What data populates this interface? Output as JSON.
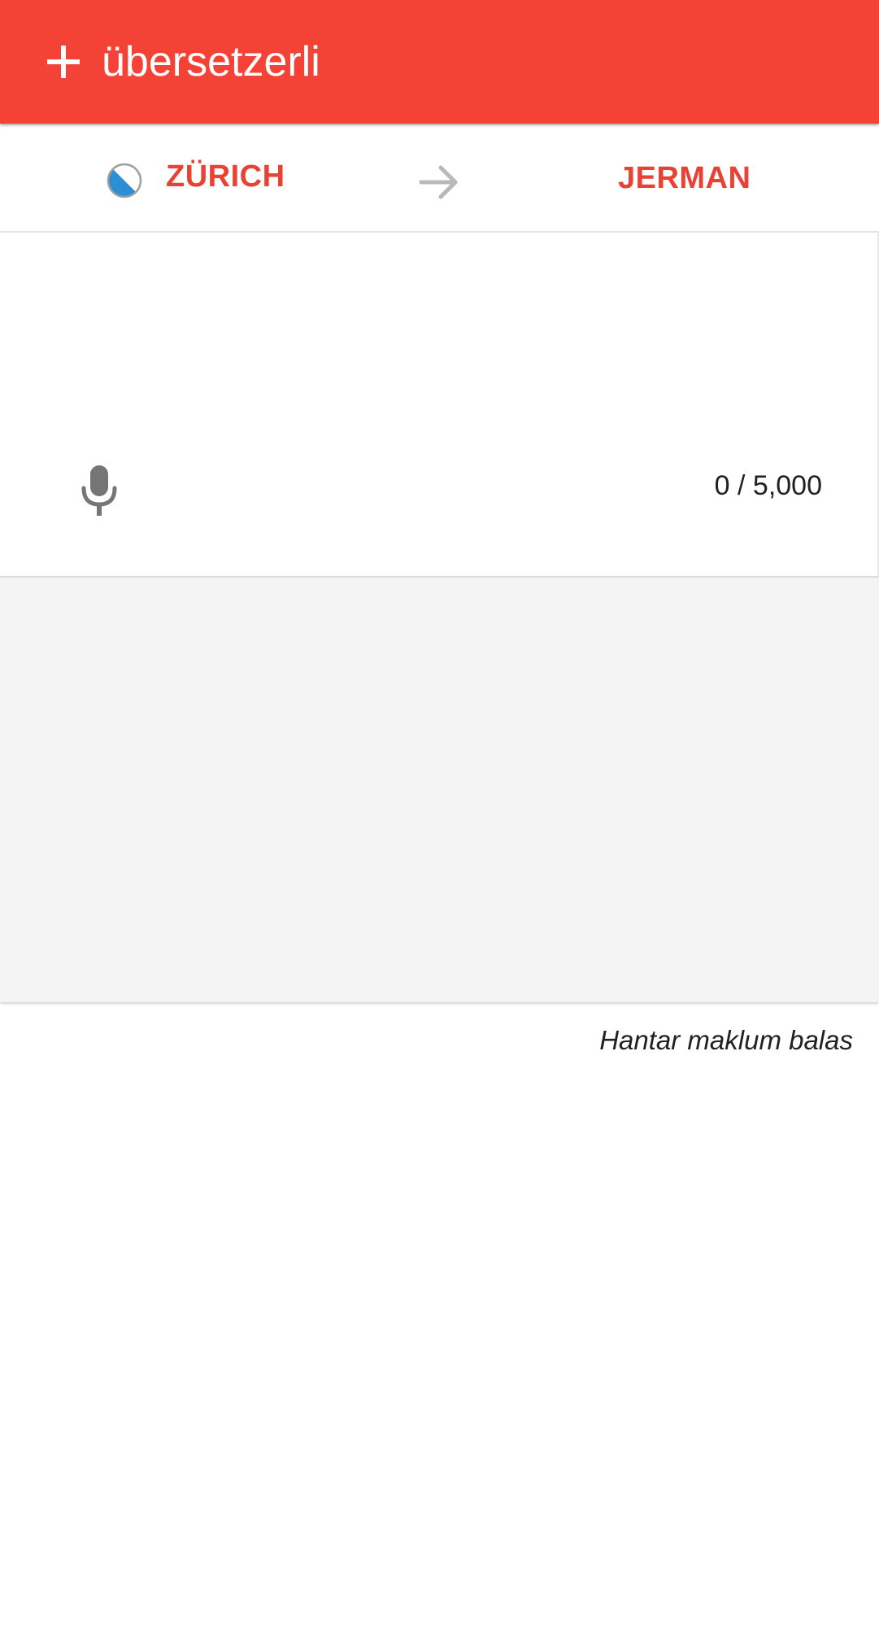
{
  "app_bar": {
    "title": "übersetzerli",
    "add_icon": "plus-icon",
    "background_color": "#f44336"
  },
  "language_bar": {
    "source_language": "ZÜRICH",
    "source_flag_icon": "zurich-flag-icon",
    "swap_icon": "arrow-right-icon",
    "target_language": "JERMAN",
    "label_color": "#e94235"
  },
  "input": {
    "value": "",
    "mic_icon": "microphone-icon",
    "char_counter": "0 / 5,000"
  },
  "output": {
    "background_color": "#f4f4f4"
  },
  "footer": {
    "feedback_label": "Hantar maklum balas"
  }
}
